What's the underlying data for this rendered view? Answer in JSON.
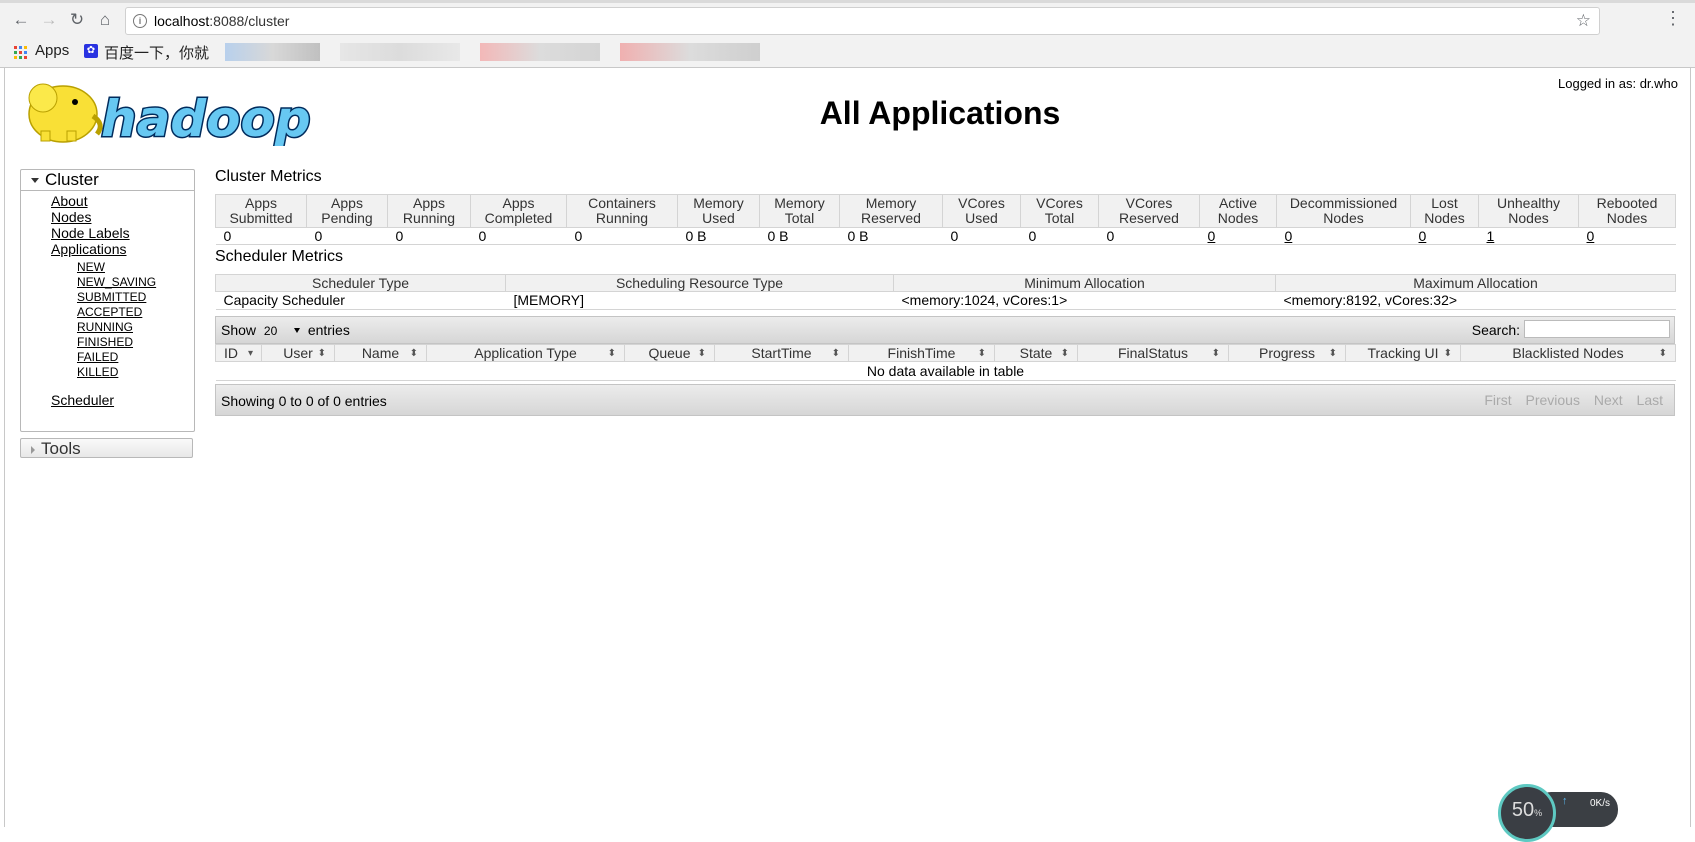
{
  "browser": {
    "url_host": "localhost",
    "url_rest": ":8088/cluster",
    "bookmarks": {
      "apps_label": "Apps",
      "baidu_label": "百度一下，你就"
    }
  },
  "header": {
    "title": "All Applications",
    "logged_in": "Logged in as: dr.who"
  },
  "sidebar": {
    "cluster_label": "Cluster",
    "links": {
      "about": "About",
      "nodes": "Nodes",
      "node_labels": "Node Labels",
      "applications": "Applications",
      "scheduler": "Scheduler"
    },
    "app_states": [
      "NEW",
      "NEW_SAVING",
      "SUBMITTED",
      "ACCEPTED",
      "RUNNING",
      "FINISHED",
      "FAILED",
      "KILLED"
    ],
    "tools_label": "Tools"
  },
  "cluster_metrics": {
    "title": "Cluster Metrics",
    "columns": [
      {
        "h1": "Apps",
        "h2": "Submitted",
        "value": "0",
        "link": false
      },
      {
        "h1": "Apps",
        "h2": "Pending",
        "value": "0",
        "link": false
      },
      {
        "h1": "Apps",
        "h2": "Running",
        "value": "0",
        "link": false
      },
      {
        "h1": "Apps",
        "h2": "Completed",
        "value": "0",
        "link": false
      },
      {
        "h1": "Containers",
        "h2": "Running",
        "value": "0",
        "link": false
      },
      {
        "h1": "Memory",
        "h2": "Used",
        "value": "0 B",
        "link": false
      },
      {
        "h1": "Memory",
        "h2": "Total",
        "value": "0 B",
        "link": false
      },
      {
        "h1": "Memory",
        "h2": "Reserved",
        "value": "0 B",
        "link": false
      },
      {
        "h1": "VCores",
        "h2": "Used",
        "value": "0",
        "link": false
      },
      {
        "h1": "VCores",
        "h2": "Total",
        "value": "0",
        "link": false
      },
      {
        "h1": "VCores",
        "h2": "Reserved",
        "value": "0",
        "link": false
      },
      {
        "h1": "Active",
        "h2": "Nodes",
        "value": "0",
        "link": true
      },
      {
        "h1": "Decommissioned",
        "h2": "Nodes",
        "value": "0",
        "link": true
      },
      {
        "h1": "Lost",
        "h2": "Nodes",
        "value": "0",
        "link": true
      },
      {
        "h1": "Unhealthy",
        "h2": "Nodes",
        "value": "1",
        "link": true
      },
      {
        "h1": "Rebooted",
        "h2": "Nodes",
        "value": "0",
        "link": true
      }
    ]
  },
  "scheduler_metrics": {
    "title": "Scheduler Metrics",
    "headers": [
      "Scheduler Type",
      "Scheduling Resource Type",
      "Minimum Allocation",
      "Maximum Allocation"
    ],
    "row": [
      "Capacity Scheduler",
      "[MEMORY]",
      "<memory:1024, vCores:1>",
      "<memory:8192, vCores:32>"
    ]
  },
  "apps_table": {
    "show_label": "Show",
    "entries_value": "20",
    "entries_label": "entries",
    "search_label": "Search:",
    "headers": [
      "ID",
      "User",
      "Name",
      "Application Type",
      "Queue",
      "StartTime",
      "FinishTime",
      "State",
      "FinalStatus",
      "Progress",
      "Tracking UI",
      "Blacklisted Nodes"
    ],
    "empty_message": "No data available in table",
    "info": "Showing 0 to 0 of 0 entries",
    "pager": [
      "First",
      "Previous",
      "Next",
      "Last"
    ]
  },
  "speed_widget": {
    "percent": "50",
    "percent_unit": "%",
    "rate": "0K/s"
  }
}
